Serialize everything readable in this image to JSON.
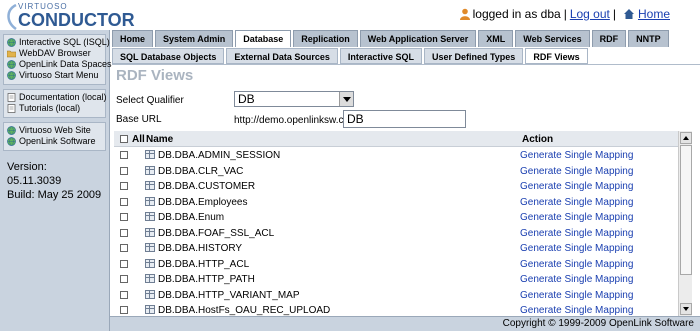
{
  "header": {
    "logo_top": "VIRTUOSO",
    "logo_main": "CONDUCTOR",
    "logged_in_text": "logged in as dba",
    "separator": "|",
    "logout_label": "Log out",
    "home_label": "Home"
  },
  "sidebar": {
    "group1": [
      {
        "label": "Interactive SQL (ISQL)",
        "icon": "globe-icon"
      },
      {
        "label": "WebDAV Browser",
        "icon": "folder-icon"
      },
      {
        "label": "OpenLink Data Spaces",
        "icon": "globe-icon"
      },
      {
        "label": "Virtuoso Start Menu",
        "icon": "globe-icon"
      }
    ],
    "group2": [
      {
        "label": "Documentation (local)",
        "icon": "document-icon"
      },
      {
        "label": "Tutorials (local)",
        "icon": "document-icon"
      }
    ],
    "group3": [
      {
        "label": "Virtuoso Web Site",
        "icon": "globe-icon"
      },
      {
        "label": "OpenLink Software",
        "icon": "globe-icon"
      }
    ],
    "version": "Version: 05.11.3039",
    "build": "Build: May 25 2009"
  },
  "tabs": [
    "Home",
    "System Admin",
    "Database",
    "Replication",
    "Web Application Server",
    "XML",
    "Web Services",
    "RDF",
    "NNTP"
  ],
  "active_tab": "Database",
  "subtabs": [
    "SQL Database Objects",
    "External Data Sources",
    "Interactive SQL",
    "User Defined Types",
    "RDF Views"
  ],
  "active_subtab": "RDF Views",
  "page_title": "RDF Views",
  "form": {
    "qualifier_label": "Select Qualifier",
    "qualifier_value": "DB",
    "base_url_label": "Base URL",
    "base_url_prefix": "http://demo.openlinksw.com/",
    "base_url_value": "DB"
  },
  "table": {
    "col_all": "All",
    "col_name": "Name",
    "col_action": "Action",
    "rows": [
      {
        "name": "DB.DBA.ADMIN_SESSION",
        "action": "Generate Single Mapping"
      },
      {
        "name": "DB.DBA.CLR_VAC",
        "action": "Generate Single Mapping"
      },
      {
        "name": "DB.DBA.CUSTOMER",
        "action": "Generate Single Mapping"
      },
      {
        "name": "DB.DBA.Employees",
        "action": "Generate Single Mapping"
      },
      {
        "name": "DB.DBA.Enum",
        "action": "Generate Single Mapping"
      },
      {
        "name": "DB.DBA.FOAF_SSL_ACL",
        "action": "Generate Single Mapping"
      },
      {
        "name": "DB.DBA.HISTORY",
        "action": "Generate Single Mapping"
      },
      {
        "name": "DB.DBA.HTTP_ACL",
        "action": "Generate Single Mapping"
      },
      {
        "name": "DB.DBA.HTTP_PATH",
        "action": "Generate Single Mapping"
      },
      {
        "name": "DB.DBA.HTTP_VARIANT_MAP",
        "action": "Generate Single Mapping"
      },
      {
        "name": "DB.DBA.HostFs_OAU_REC_UPLOAD",
        "action": "Generate Single Mapping"
      }
    ]
  },
  "footer": {
    "copyright": "Copyright © 1999-2009 OpenLink Software"
  },
  "colors": {
    "link": "#1a3fb0",
    "sidebar_bg": "#c9d3df",
    "tab_bg": "#b7c2cf",
    "title_color": "#aab4c0"
  }
}
